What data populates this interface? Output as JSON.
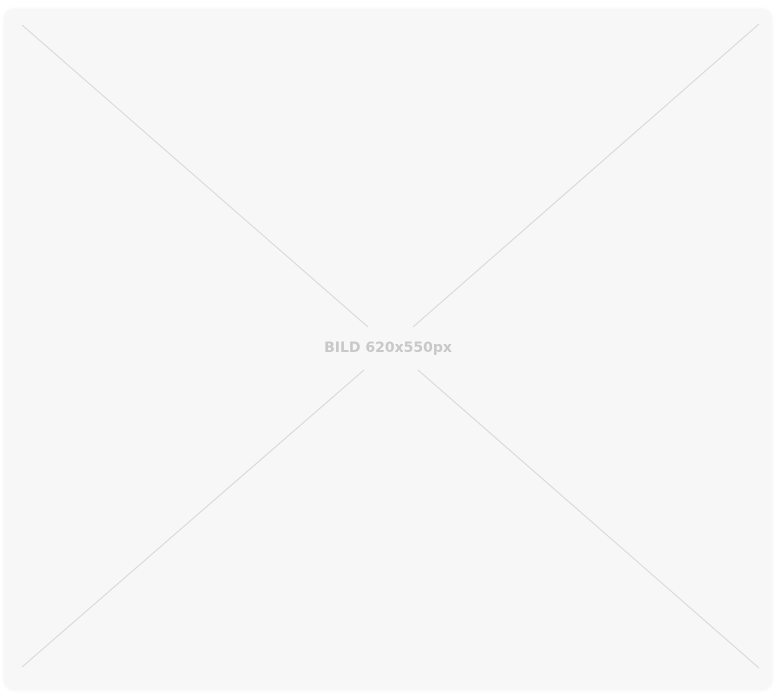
{
  "image_placeholder": {
    "label": "BILD 620x550px",
    "colors": {
      "background": "#f7f7f7",
      "cross_lines": "#d6d6d6",
      "label": "#c8c8c8"
    }
  }
}
